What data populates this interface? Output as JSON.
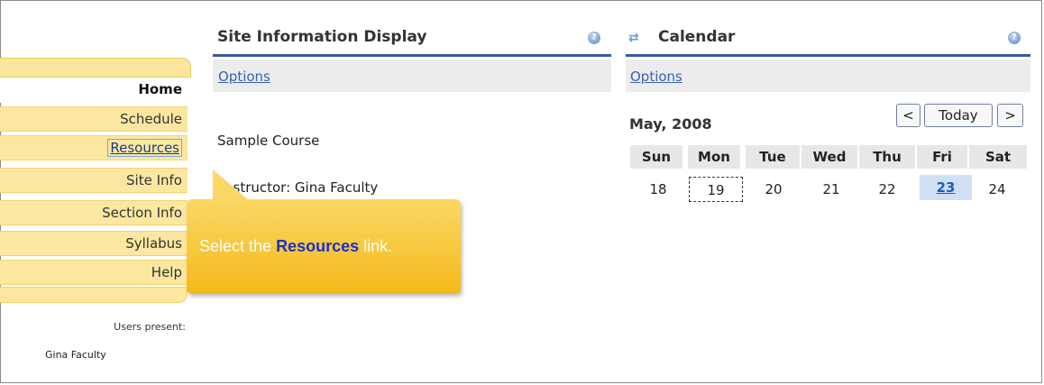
{
  "sidebar": {
    "items": [
      {
        "label": "Home"
      },
      {
        "label": "Schedule"
      },
      {
        "label": "Resources"
      },
      {
        "label": "Site Info"
      },
      {
        "label": "Section Info"
      },
      {
        "label": "Syllabus"
      },
      {
        "label": "Help"
      }
    ],
    "users_present_label": "Users present:",
    "users": [
      {
        "name": "Gina Faculty"
      }
    ]
  },
  "site_info": {
    "title": "Site Information Display",
    "options": "Options",
    "course": "Sample Course",
    "instructor": "nstructor: Gina Faculty"
  },
  "calendar": {
    "title": "Calendar",
    "options": "Options",
    "month": "May, 2008",
    "prev": "<",
    "today": "Today",
    "next": ">",
    "days": [
      "Sun",
      "Mon",
      "Tue",
      "Wed",
      "Thu",
      "Fri",
      "Sat"
    ],
    "dates": [
      "18",
      "19",
      "20",
      "21",
      "22",
      "23",
      "24"
    ],
    "today_date": "19",
    "selected_date": "23"
  },
  "callout": {
    "prefix": "Select the ",
    "link": "Resources",
    "suffix": " link."
  },
  "icons": {
    "help": "help-icon",
    "refresh": "refresh-icon"
  }
}
